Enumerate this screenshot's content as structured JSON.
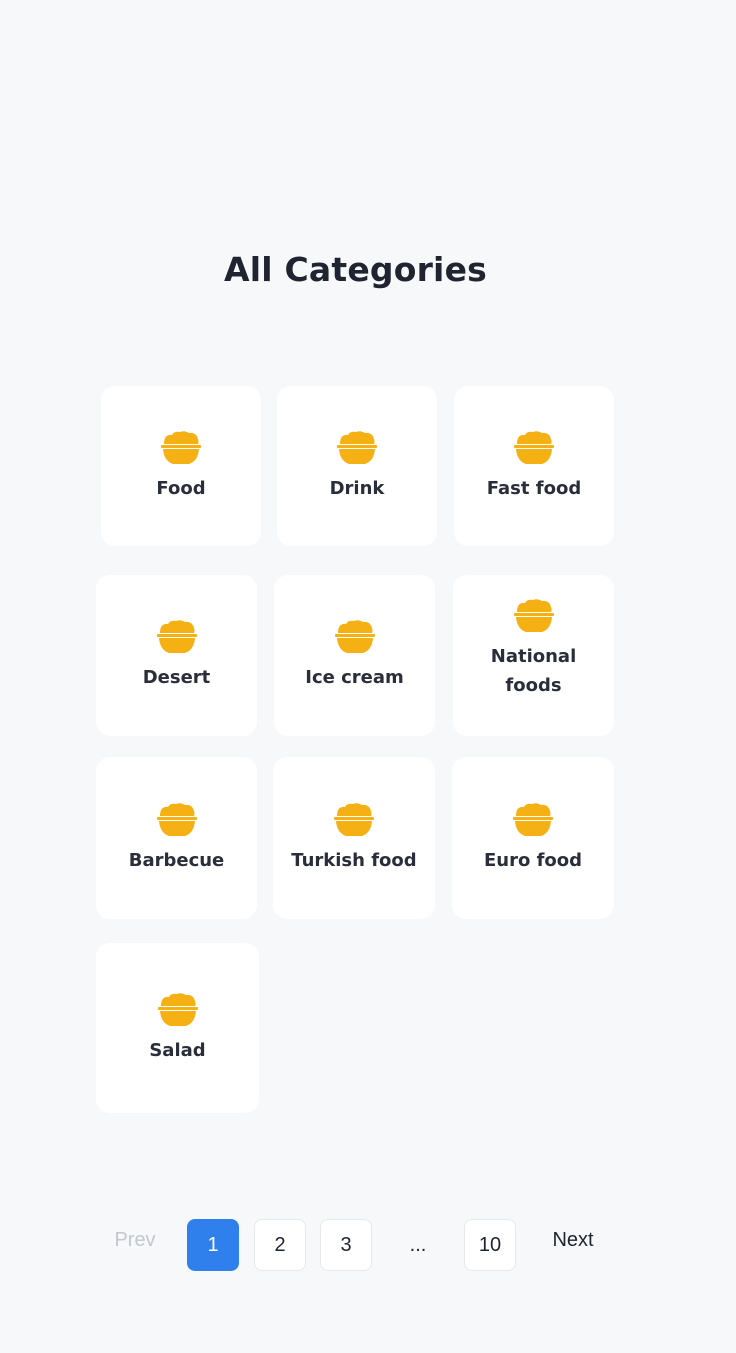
{
  "title": "All Categories",
  "colors": {
    "background": "#f7f8fa",
    "card": "#ffffff",
    "icon": "#f5b014",
    "accent": "#2f80ed",
    "disabled": "#c3c7cf"
  },
  "categories": [
    {
      "label": "Food",
      "icon": "bowl-icon"
    },
    {
      "label": "Drink",
      "icon": "bowl-icon"
    },
    {
      "label": "Fast food",
      "icon": "bowl-icon"
    },
    {
      "label": "Desert",
      "icon": "bowl-icon"
    },
    {
      "label": "Ice cream",
      "icon": "bowl-icon"
    },
    {
      "label": "National foods",
      "icon": "bowl-icon"
    },
    {
      "label": "Barbecue",
      "icon": "bowl-icon"
    },
    {
      "label": "Turkish food",
      "icon": "bowl-icon"
    },
    {
      "label": "Euro food",
      "icon": "bowl-icon"
    },
    {
      "label": "Salad",
      "icon": "bowl-icon"
    }
  ],
  "pagination": {
    "prev": "Prev",
    "next": "Next",
    "pages": [
      "1",
      "2",
      "3"
    ],
    "ellipsis": "...",
    "last": "10",
    "current": "1"
  }
}
